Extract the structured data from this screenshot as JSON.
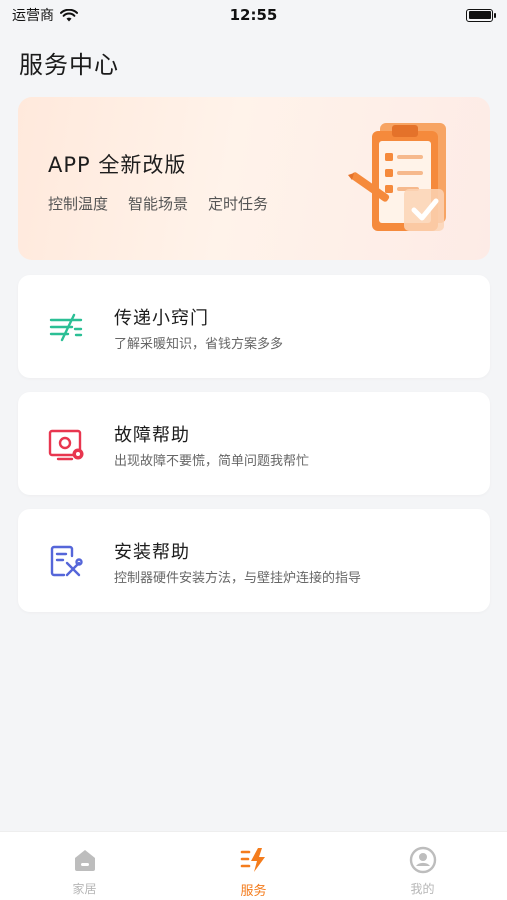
{
  "status_bar": {
    "carrier": "运营商",
    "time": "12:55"
  },
  "page": {
    "title": "服务中心"
  },
  "banner": {
    "title": "APP 全新改版",
    "tags": [
      "控制温度",
      "智能场景",
      "定时任务"
    ]
  },
  "cards": [
    {
      "title": "传递小窍门",
      "subtitle": "了解采暖知识，省钱方案多多",
      "icon": "tips-icon",
      "color": "#2bbf95"
    },
    {
      "title": "故障帮助",
      "subtitle": "出现故障不要慌，简单问题我帮忙",
      "icon": "fault-icon",
      "color": "#e8364f"
    },
    {
      "title": "安装帮助",
      "subtitle": "控制器硬件安装方法，与壁挂炉连接的指导",
      "icon": "install-icon",
      "color": "#5566d9"
    }
  ],
  "tabbar": {
    "items": [
      {
        "label": "家居",
        "icon": "home-icon",
        "active": false
      },
      {
        "label": "服务",
        "icon": "service-icon",
        "active": true
      },
      {
        "label": "我的",
        "icon": "profile-icon",
        "active": false
      }
    ],
    "active_color": "#f47c1c"
  }
}
